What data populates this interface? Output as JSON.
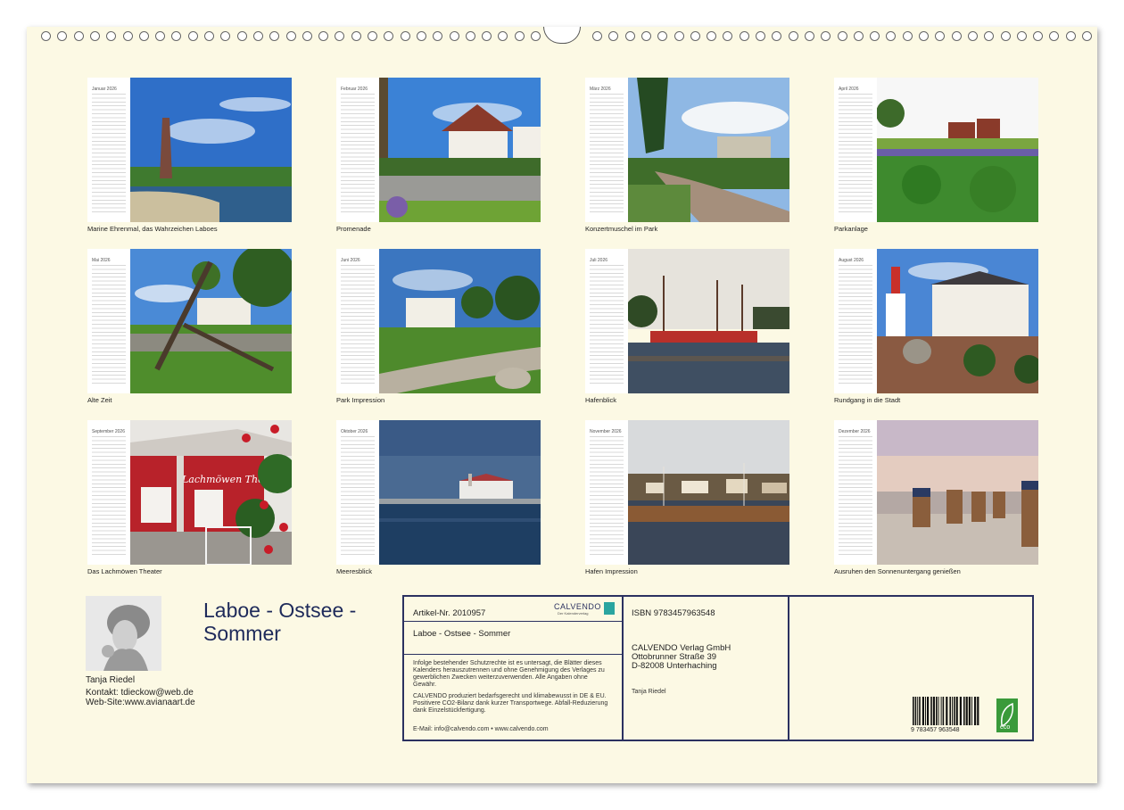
{
  "months": [
    {
      "name": "Januar 2026",
      "caption": "Marine Ehrenmal, das Wahrzeichen Laboes"
    },
    {
      "name": "Februar 2026",
      "caption": "Promenade"
    },
    {
      "name": "März 2026",
      "caption": "Konzertmuschel im Park"
    },
    {
      "name": "April 2026",
      "caption": "Parkanlage"
    },
    {
      "name": "Mai 2026",
      "caption": "Alte Zeit"
    },
    {
      "name": "Juni 2026",
      "caption": "Park Impression"
    },
    {
      "name": "Juli 2026",
      "caption": "Hafenblick"
    },
    {
      "name": "August 2026",
      "caption": "Rundgang in die Stadt"
    },
    {
      "name": "September 2026",
      "caption": "Das Lachmöwen Theater"
    },
    {
      "name": "Oktober 2026",
      "caption": "Meeresblick"
    },
    {
      "name": "November 2026",
      "caption": "Hafen Impression"
    },
    {
      "name": "Dezember 2026",
      "caption": "Ausruhen den Sonnenuntergang genießen"
    }
  ],
  "theater_sign": "Lachmöwen Theater",
  "author": {
    "name": "Tanja Riedel",
    "contact": "Kontakt: tdieckow@web.de",
    "website": "Web-Site:www.avianaart.de"
  },
  "title": "Laboe - Ostsee - Sommer",
  "info": {
    "article": "Artikel-Nr. 2010957",
    "logo_text": "CALVENDO",
    "logo_sub": "Der Kalenderverlag",
    "title": "Laboe - Ostsee - Sommer",
    "legal": "Infolge bestehender Schutzrechte ist es untersagt, die Blätter dieses Kalenders herauszutrennen und ohne Genehmigung des Verlages zu gewerblichen Zwecken weiterzuverwenden. Alle Angaben ohne Gewähr.",
    "climate": "CALVENDO produziert bedarfsgerecht und klimabewusst in DE & EU. Positivere CO2-Bilanz dank kurzer Transportwege. Abfall-Reduzierung dank Einzelstückfertigung.",
    "email": "E-Mail: info@calvendo.com • www.calvendo.com",
    "isbn": "ISBN 9783457963548",
    "publisher": "CALVENDO Verlag GmbH",
    "street": "Ottobrunner Straße 39",
    "city": "D-82008 Unterhaching",
    "author": "Tanja Riedel",
    "barcode_text": "9 783457 963548",
    "eco_label": "eco"
  },
  "colors": {
    "sheet": "#fcf9e4",
    "border": "#2b3160",
    "title": "#1e2a5a",
    "sky": "#3a78c8",
    "grass": "#4a8a2a"
  }
}
